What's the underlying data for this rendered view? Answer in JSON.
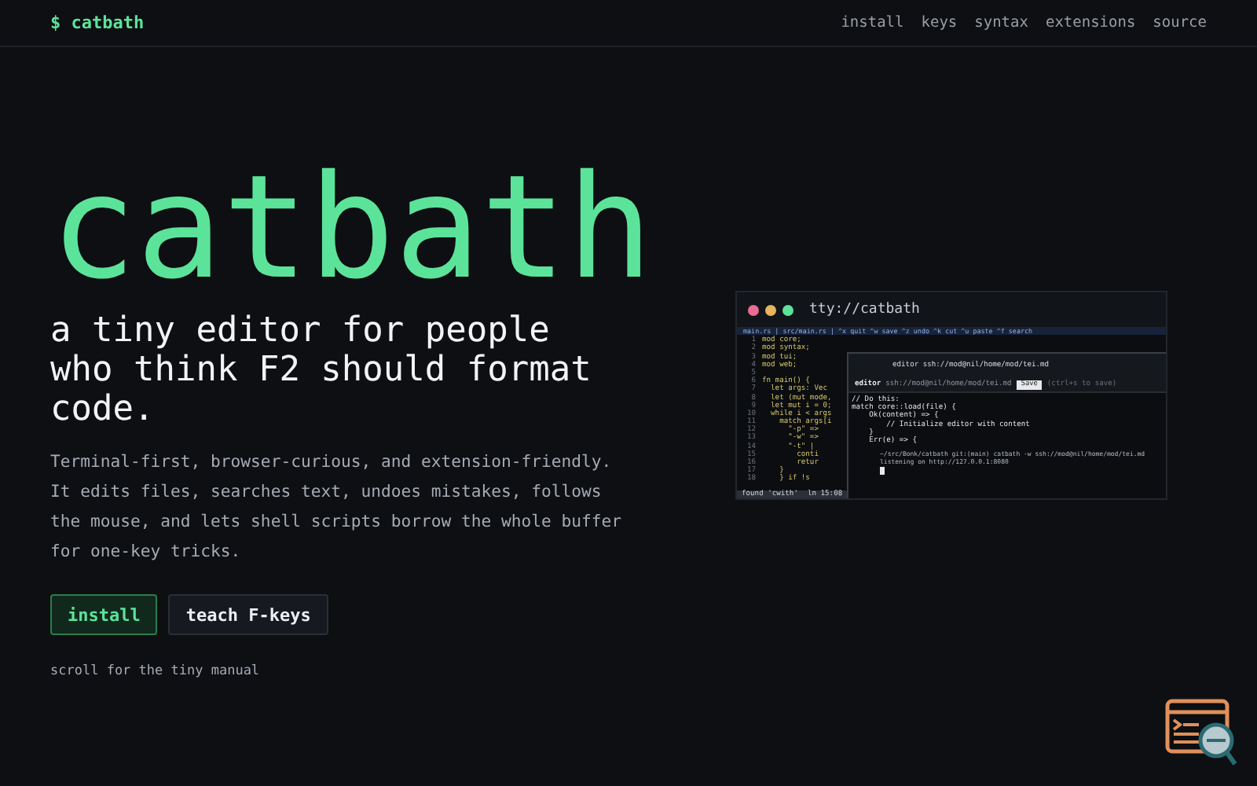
{
  "header": {
    "logo": "$ catbath",
    "nav": [
      "install",
      "keys",
      "syntax",
      "extensions",
      "source"
    ]
  },
  "hero": {
    "title": "catbath",
    "subtitle": "a tiny editor for people who think F2 should format code.",
    "description": "Terminal-first, browser-curious, and extension-friendly. It edits files, searches text, undoes mistakes, follows the mouse, and lets shell scripts borrow the whole buffer for one-key tricks.",
    "buttons": [
      {
        "label": "install",
        "kind": "primary"
      },
      {
        "label": "teach F-keys",
        "kind": "secondary"
      }
    ],
    "scroll_hint": "scroll for the tiny manual"
  },
  "preview": {
    "title": "tty://catbath",
    "tabbar": "main.rs | src/main.rs | ^x quit ^w save ^z undo ^k cut ^u paste ^f search",
    "code": [
      {
        "num": "1",
        "text": "mod core;"
      },
      {
        "num": "2",
        "text": "mod syntax;"
      },
      {
        "num": "3",
        "text": "mod tui;"
      },
      {
        "num": "4",
        "text": "mod web;"
      },
      {
        "num": "5"
      },
      {
        "num": "6",
        "text": "fn main() {"
      },
      {
        "num": "7",
        "text": "  let args: Vec"
      },
      {
        "num": "8",
        "text": "  let (mut mode,"
      },
      {
        "num": "9",
        "text": "  let mut i = 0;"
      },
      {
        "num": "10",
        "text": "  while i < args"
      },
      {
        "num": "11",
        "text": "    match args[i"
      },
      {
        "num": "12",
        "text": "      \"-p\" =>"
      },
      {
        "num": "13",
        "text": "      \"-w\" =>"
      },
      {
        "num": "14",
        "text": "      \"-t\" |"
      },
      {
        "num": "15",
        "text": "        conti"
      },
      {
        "num": "16",
        "text": "        retur"
      },
      {
        "num": "17",
        "text": "    }"
      },
      {
        "num": "18",
        "text": "    } if !s"
      }
    ],
    "status": [
      "found 'cwith'",
      "ln 15:08"
    ],
    "overlay": {
      "title": "editor ssh://mod@nil/home/mod/tei.md",
      "path": "ssh://mod@nil/home/mod/tei.md",
      "app": "editor",
      "save": "Save",
      "hint": "(ctrl+s to save)",
      "lines": [
        "// Do this:",
        "match core::load(file) {",
        "    Ok(content) => {",
        "        // Initialize editor with content",
        "    }",
        "    Err(e) => {"
      ],
      "shell": [
        "~/src/Bonk/catbath git:(main) catbath -w ssh://mod@nil/home/mod/tei.md",
        "listening on http://127.0.0.1:8080"
      ]
    }
  }
}
